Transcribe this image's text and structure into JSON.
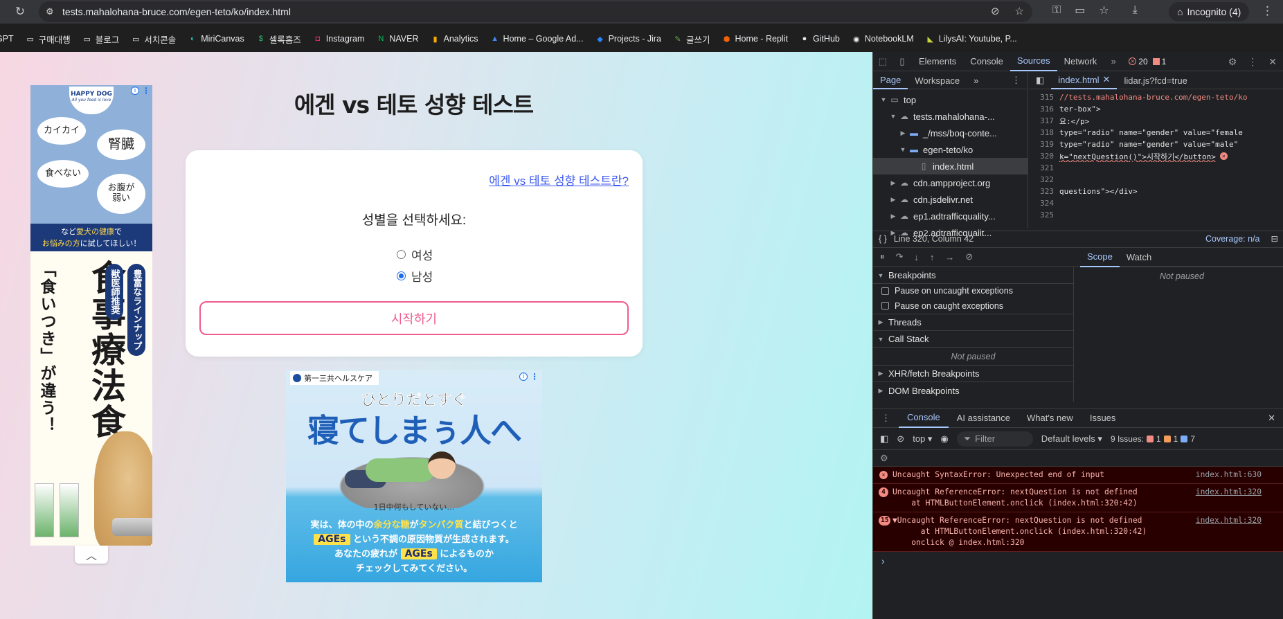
{
  "browser": {
    "url": "tests.mahalohana-bruce.com/egen-teto/ko/index.html",
    "incognito_label": "Incognito (4)"
  },
  "bookmarks": [
    {
      "label": "GPT",
      "icon": "chat-icon",
      "color": "#e8eaed"
    },
    {
      "label": "구매대행",
      "icon": "folder-icon",
      "color": "#e8eaed"
    },
    {
      "label": "블로그",
      "icon": "folder-icon",
      "color": "#e8eaed"
    },
    {
      "label": "서치콘솔",
      "icon": "folder-icon",
      "color": "#e8eaed"
    },
    {
      "label": "MiriCanvas",
      "icon": "miricanvas-icon",
      "color": "#22c3c3"
    },
    {
      "label": "셀록홈즈",
      "icon": "sellock-icon",
      "color": "#2fb36b"
    },
    {
      "label": "Instagram",
      "icon": "instagram-icon",
      "color": "#e1306c"
    },
    {
      "label": "NAVER",
      "icon": "naver-icon",
      "color": "#03c75a"
    },
    {
      "label": "Analytics",
      "icon": "analytics-icon",
      "color": "#f9ab00"
    },
    {
      "label": "Home – Google Ad...",
      "icon": "google-ads-icon",
      "color": "#4285f4"
    },
    {
      "label": "Projects - Jira",
      "icon": "jira-icon",
      "color": "#2684ff"
    },
    {
      "label": "글쓰기",
      "icon": "write-icon",
      "color": "#6aa84f"
    },
    {
      "label": "Home - Replit",
      "icon": "replit-icon",
      "color": "#f26207"
    },
    {
      "label": "GitHub",
      "icon": "github-icon",
      "color": "#e8eaed"
    },
    {
      "label": "NotebookLM",
      "icon": "notebooklm-icon",
      "color": "#e8eaed"
    },
    {
      "label": "LilysAI: Youtube, P...",
      "icon": "lilys-icon",
      "color": "#c7d53a"
    }
  ],
  "page": {
    "title": "에겐 vs 테토 성향 테스트",
    "about_link": "에겐 vs 테토 성향 테스트란?",
    "gender_prompt": "성별을 선택하세요:",
    "options": [
      {
        "label": "여성",
        "checked": false
      },
      {
        "label": "남성",
        "checked": true
      }
    ],
    "start_button": "시작하기",
    "accent_color": "#f05a8d"
  },
  "ad_left": {
    "brand": "HAPPY DOG",
    "brand_tagline": "All you feed is love",
    "bubbles": [
      "カイカイ",
      "腎臓",
      "食べない",
      "お腹が弱い"
    ],
    "band_line1_prefix": "など",
    "band_line1_highlight": "愛犬の健康",
    "band_line1_suffix": "で",
    "band_line2_highlight": "お悩みの方",
    "band_line2_suffix": "に試してほしい！",
    "headline": "食事療法食",
    "subline": "「食いつき」が違う！",
    "pill1": "獣医師推奨",
    "pill2": "豊富なラインナップ"
  },
  "ad_mid": {
    "brand": "第一三共ヘルスケア",
    "headline1": "ひとりだとすぐ",
    "headline2": "寝てしまぅ人へ",
    "caption": "1日中何もしていない…",
    "copy_line1_prefix": "実は、体の中の",
    "copy_line1_highlight": "余分な糖",
    "copy_line1_mid": "が",
    "copy_line1_highlight2": "タンパク質",
    "copy_line1_suffix": "と結びつくと",
    "copy_line2_box": "AGEs",
    "copy_line2_suffix": "という不調の原因物質が生成されます。",
    "copy_line3_prefix": "あなたの疲れが",
    "copy_line3_box": "AGEs",
    "copy_line3_suffix": "によるものか",
    "copy_line4": "チェックしてみてください。"
  },
  "devtools": {
    "tabs": [
      "Elements",
      "Console",
      "Sources",
      "Network"
    ],
    "active_tab": "Sources",
    "error_count": "20",
    "warning_count": "1",
    "nav_tabs": [
      "Page",
      "Workspace"
    ],
    "tree": [
      {
        "label": "top",
        "indent": 0,
        "arrow": "▼",
        "icon": "frame-icon"
      },
      {
        "label": "tests.mahalohana-...",
        "indent": 1,
        "arrow": "▼",
        "icon": "cloud-icon"
      },
      {
        "label": "_/mss/boq-conte...",
        "indent": 2,
        "arrow": "▶",
        "icon": "folder-icon"
      },
      {
        "label": "egen-teto/ko",
        "indent": 2,
        "arrow": "▼",
        "icon": "folder-icon"
      },
      {
        "label": "index.html",
        "indent": 3,
        "arrow": "",
        "icon": "file-icon"
      },
      {
        "label": "cdn.ampproject.org",
        "indent": 1,
        "arrow": "▶",
        "icon": "cloud-icon"
      },
      {
        "label": "cdn.jsdelivr.net",
        "indent": 1,
        "arrow": "▶",
        "icon": "cloud-icon"
      },
      {
        "label": "ep1.adtrafficquality...",
        "indent": 1,
        "arrow": "▶",
        "icon": "cloud-icon"
      },
      {
        "label": "ep2.adtrafficqualit...",
        "indent": 1,
        "arrow": "▶",
        "icon": "cloud-icon"
      }
    ],
    "editor_tabs": [
      "index.html",
      "lidar.js?fcd=true"
    ],
    "code": [
      {
        "ln": "315",
        "text": "//tests.mahalohana-bruce.com/egen-teto/ko"
      },
      {
        "ln": "316",
        "text": "ter-box\">"
      },
      {
        "ln": "317",
        "text": "요:</p>"
      },
      {
        "ln": "318",
        "text": " type=\"radio\" name=\"gender\" value=\"female"
      },
      {
        "ln": "319",
        "text": " type=\"radio\" name=\"gender\" value=\"male\""
      },
      {
        "ln": "320",
        "text": "k=\"nextQuestion()\">시작하기</button>"
      },
      {
        "ln": "321",
        "text": ""
      },
      {
        "ln": "322",
        "text": ""
      },
      {
        "ln": "323",
        "text": "questions\"></div>"
      },
      {
        "ln": "324",
        "text": ""
      },
      {
        "ln": "325",
        "text": ""
      }
    ],
    "cursor_pos": "Line 320, Column 42",
    "coverage": "Coverage: n/a",
    "breakpoints_label": "Breakpoints",
    "pause_uncaught": "Pause on uncaught exceptions",
    "pause_caught": "Pause on caught exceptions",
    "threads": "Threads",
    "call_stack": "Call Stack",
    "not_paused": "Not paused",
    "xhr_breakpoints": "XHR/fetch Breakpoints",
    "dom_breakpoints": "DOM Breakpoints",
    "scope_tabs": [
      "Scope",
      "Watch"
    ],
    "drawer_tabs": [
      "Console",
      "AI assistance",
      "What's new",
      "Issues"
    ],
    "context": "top",
    "filter_placeholder": "Filter",
    "levels": "Default levels",
    "issues_label": "9 Issues:",
    "issues_red": "1",
    "issues_orange": "1",
    "issues_blue": "7",
    "messages": [
      {
        "count": "",
        "text": "Uncaught SyntaxError: Unexpected end of input",
        "loc": "index.html:630",
        "link": false
      },
      {
        "count": "4",
        "text": "Uncaught ReferenceError: nextQuestion is not defined\n    at HTMLButtonElement.onclick (index.html:320:42)",
        "loc": "index.html:320",
        "link": true
      },
      {
        "count": "15",
        "text": "▼Uncaught ReferenceError: nextQuestion is not defined\n      at HTMLButtonElement.onclick (index.html:320:42)\n    onclick @ index.html:320",
        "loc": "index.html:320",
        "link": true
      }
    ]
  }
}
